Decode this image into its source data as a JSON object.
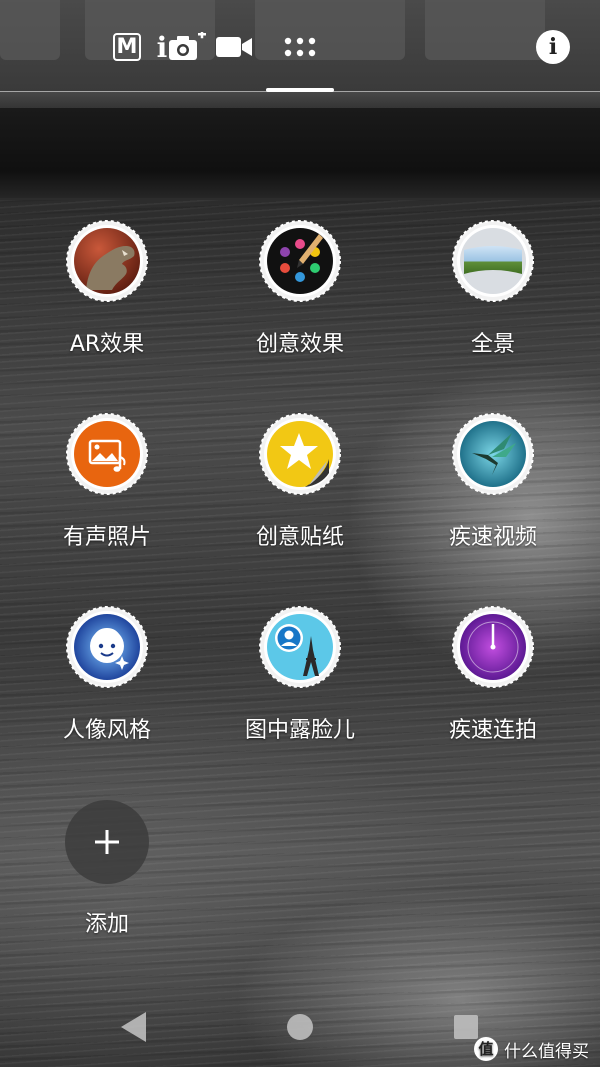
{
  "top_bar": {
    "tabs": [
      {
        "name": "manual-mode",
        "icon": "manual-m-icon",
        "label": "M"
      },
      {
        "name": "photo-plus",
        "icon": "camera-plus-icon",
        "label": "i"
      },
      {
        "name": "video",
        "icon": "video-camera-icon"
      },
      {
        "name": "camera-apps",
        "icon": "grid-dots-icon",
        "selected": true
      }
    ],
    "info_label": "i"
  },
  "modes": [
    {
      "label": "AR效果",
      "icon": "dinosaur-icon"
    },
    {
      "label": "创意效果",
      "icon": "palette-icon"
    },
    {
      "label": "全景",
      "icon": "panorama-icon"
    },
    {
      "label": "有声照片",
      "icon": "sound-photo-icon"
    },
    {
      "label": "创意贴纸",
      "icon": "sticker-star-icon"
    },
    {
      "label": "疾速视频",
      "icon": "hummingbird-icon"
    },
    {
      "label": "人像风格",
      "icon": "portrait-style-icon"
    },
    {
      "label": "图中露脸儿",
      "icon": "face-in-picture-icon"
    },
    {
      "label": "疾速连拍",
      "icon": "burst-timer-icon"
    }
  ],
  "add": {
    "label": "添加",
    "icon": "plus-icon"
  },
  "nav": {
    "back": "back-icon",
    "home": "home-icon",
    "recents": "recents-icon"
  },
  "watermark": {
    "logo": "值",
    "text": "什么值得买"
  },
  "colors": {
    "accent": "#ffffff",
    "scallop": "#f2f2f2"
  }
}
